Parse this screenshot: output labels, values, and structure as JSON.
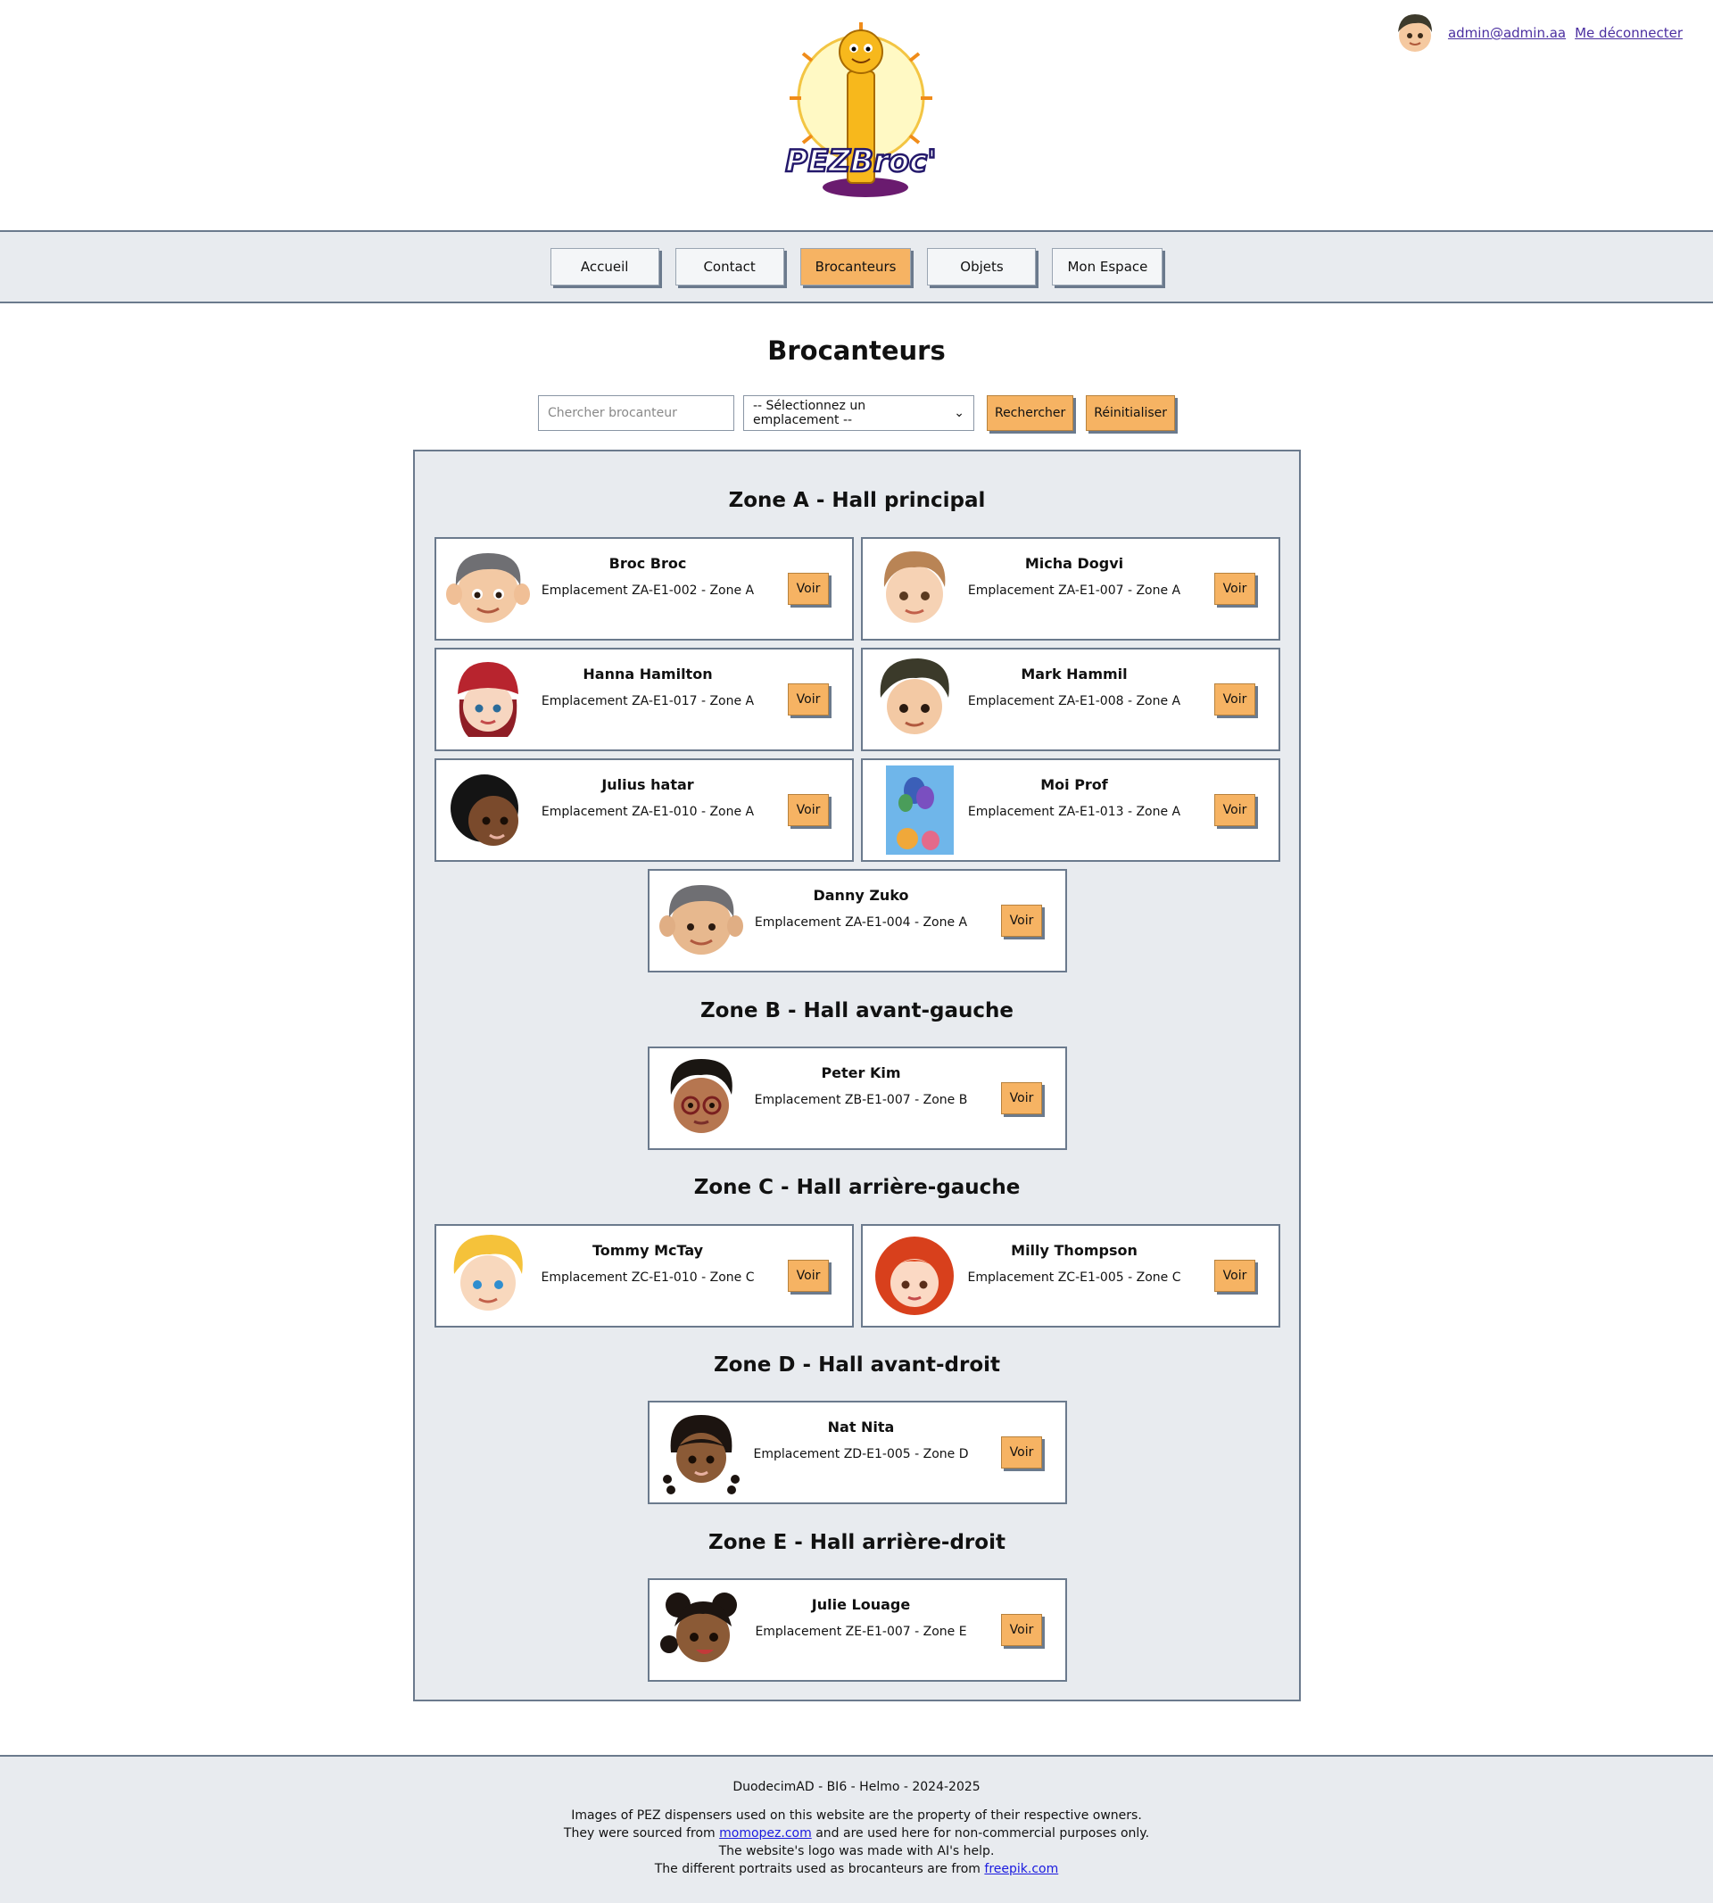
{
  "header": {
    "logo_text": "PEZBroc'",
    "user_email": "admin@admin.aa",
    "logout_label": "Me déconnecter"
  },
  "nav": {
    "items": [
      "Accueil",
      "Contact",
      "Brocanteurs",
      "Objets",
      "Mon Espace"
    ],
    "active": "Brocanteurs"
  },
  "page": {
    "title": "Brocanteurs"
  },
  "search": {
    "placeholder": "Chercher brocanteur",
    "select_value": "-- Sélectionnez un emplacement --",
    "search_label": "Rechercher",
    "reset_label": "Réinitialiser"
  },
  "zones": [
    {
      "title": "Zone A - Hall principal",
      "vendors": [
        {
          "name": "Broc Broc",
          "location": "Emplacement ZA-E1-002 - Zone A",
          "button": "Voir",
          "portrait": "boy-gray-hair"
        },
        {
          "name": "Micha Dogvi",
          "location": "Emplacement ZA-E1-007 - Zone A",
          "button": "Voir",
          "portrait": "boy-brown-hair"
        },
        {
          "name": "Hanna Hamilton",
          "location": "Emplacement ZA-E1-017 - Zone A",
          "button": "Voir",
          "portrait": "girl-red-hat"
        },
        {
          "name": "Mark Hammil",
          "location": "Emplacement ZA-E1-008 - Zone A",
          "button": "Voir",
          "portrait": "boy-dark-hair"
        },
        {
          "name": "Julius hatar",
          "location": "Emplacement ZA-E1-010 - Zone A",
          "button": "Voir",
          "portrait": "boy-curly-black-hair"
        },
        {
          "name": "Moi Prof",
          "location": "Emplacement ZA-E1-013 - Zone A",
          "button": "Voir",
          "portrait": "balloons-photo"
        },
        {
          "name": "Danny Zuko",
          "location": "Emplacement ZA-E1-004 - Zone A",
          "button": "Voir",
          "portrait": "boy-gray-hair"
        }
      ]
    },
    {
      "title": "Zone B - Hall avant-gauche",
      "vendors": [
        {
          "name": "Peter Kim",
          "location": "Emplacement ZB-E1-007 - Zone B",
          "button": "Voir",
          "portrait": "boy-glasses"
        }
      ]
    },
    {
      "title": "Zone C - Hall arrière-gauche",
      "vendors": [
        {
          "name": "Tommy McTay",
          "location": "Emplacement ZC-E1-010 - Zone C",
          "button": "Voir",
          "portrait": "boy-blond-hair"
        },
        {
          "name": "Milly Thompson",
          "location": "Emplacement ZC-E1-005 - Zone C",
          "button": "Voir",
          "portrait": "girl-red-curly-hair"
        }
      ]
    },
    {
      "title": "Zone D - Hall avant-droit",
      "vendors": [
        {
          "name": "Nat Nita",
          "location": "Emplacement ZD-E1-005 - Zone D",
          "button": "Voir",
          "portrait": "girl-braids"
        }
      ]
    },
    {
      "title": "Zone E - Hall arrière-droit",
      "vendors": [
        {
          "name": "Julie Louage",
          "location": "Emplacement ZE-E1-007 - Zone E",
          "button": "Voir",
          "portrait": "girl-puffs"
        }
      ]
    }
  ],
  "footer": {
    "line1": "DuodecimAD - BI6 - Helmo - 2024-2025",
    "credit1": "Images of PEZ dispensers used on this website are the property of their respective owners.",
    "credit2_pre": "They were sourced from ",
    "credit2_link": "momopez.com",
    "credit2_post": " and are used here for non-commercial purposes only.",
    "credit3": "The website's logo was made with AI's help.",
    "credit4_pre": "The different portraits used as brocanteurs are from ",
    "credit4_link": "freepik.com"
  },
  "colors": {
    "accent": "#f6b363",
    "panel_bg": "#e8ebef",
    "border": "#6b7a8d",
    "link": "#4b2fa0"
  }
}
